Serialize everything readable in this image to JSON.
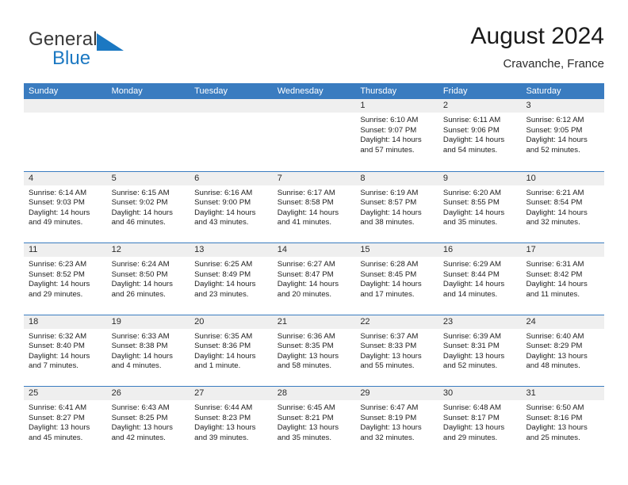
{
  "brand": {
    "line1": "General",
    "line2": "Blue",
    "mark": "triangle-logo",
    "colors": {
      "blue": "#1b78c2",
      "dark": "#3a3a3a"
    }
  },
  "header": {
    "title": "August 2024",
    "subtitle": "Cravanche, France"
  },
  "theme": {
    "header_blue": "#3a7cc0",
    "band_gray": "#efefef",
    "cell_white": "#ffffff"
  },
  "weekday_headers": [
    "Sunday",
    "Monday",
    "Tuesday",
    "Wednesday",
    "Thursday",
    "Friday",
    "Saturday"
  ],
  "weeks": [
    [
      {
        "day": "",
        "empty": true
      },
      {
        "day": "",
        "empty": true
      },
      {
        "day": "",
        "empty": true
      },
      {
        "day": "",
        "empty": true
      },
      {
        "day": "1",
        "sunrise": "Sunrise: 6:10 AM",
        "sunset": "Sunset: 9:07 PM",
        "daylight": "Daylight: 14 hours and 57 minutes."
      },
      {
        "day": "2",
        "sunrise": "Sunrise: 6:11 AM",
        "sunset": "Sunset: 9:06 PM",
        "daylight": "Daylight: 14 hours and 54 minutes."
      },
      {
        "day": "3",
        "sunrise": "Sunrise: 6:12 AM",
        "sunset": "Sunset: 9:05 PM",
        "daylight": "Daylight: 14 hours and 52 minutes."
      }
    ],
    [
      {
        "day": "4",
        "sunrise": "Sunrise: 6:14 AM",
        "sunset": "Sunset: 9:03 PM",
        "daylight": "Daylight: 14 hours and 49 minutes."
      },
      {
        "day": "5",
        "sunrise": "Sunrise: 6:15 AM",
        "sunset": "Sunset: 9:02 PM",
        "daylight": "Daylight: 14 hours and 46 minutes."
      },
      {
        "day": "6",
        "sunrise": "Sunrise: 6:16 AM",
        "sunset": "Sunset: 9:00 PM",
        "daylight": "Daylight: 14 hours and 43 minutes."
      },
      {
        "day": "7",
        "sunrise": "Sunrise: 6:17 AM",
        "sunset": "Sunset: 8:58 PM",
        "daylight": "Daylight: 14 hours and 41 minutes."
      },
      {
        "day": "8",
        "sunrise": "Sunrise: 6:19 AM",
        "sunset": "Sunset: 8:57 PM",
        "daylight": "Daylight: 14 hours and 38 minutes."
      },
      {
        "day": "9",
        "sunrise": "Sunrise: 6:20 AM",
        "sunset": "Sunset: 8:55 PM",
        "daylight": "Daylight: 14 hours and 35 minutes."
      },
      {
        "day": "10",
        "sunrise": "Sunrise: 6:21 AM",
        "sunset": "Sunset: 8:54 PM",
        "daylight": "Daylight: 14 hours and 32 minutes."
      }
    ],
    [
      {
        "day": "11",
        "sunrise": "Sunrise: 6:23 AM",
        "sunset": "Sunset: 8:52 PM",
        "daylight": "Daylight: 14 hours and 29 minutes."
      },
      {
        "day": "12",
        "sunrise": "Sunrise: 6:24 AM",
        "sunset": "Sunset: 8:50 PM",
        "daylight": "Daylight: 14 hours and 26 minutes."
      },
      {
        "day": "13",
        "sunrise": "Sunrise: 6:25 AM",
        "sunset": "Sunset: 8:49 PM",
        "daylight": "Daylight: 14 hours and 23 minutes."
      },
      {
        "day": "14",
        "sunrise": "Sunrise: 6:27 AM",
        "sunset": "Sunset: 8:47 PM",
        "daylight": "Daylight: 14 hours and 20 minutes."
      },
      {
        "day": "15",
        "sunrise": "Sunrise: 6:28 AM",
        "sunset": "Sunset: 8:45 PM",
        "daylight": "Daylight: 14 hours and 17 minutes."
      },
      {
        "day": "16",
        "sunrise": "Sunrise: 6:29 AM",
        "sunset": "Sunset: 8:44 PM",
        "daylight": "Daylight: 14 hours and 14 minutes."
      },
      {
        "day": "17",
        "sunrise": "Sunrise: 6:31 AM",
        "sunset": "Sunset: 8:42 PM",
        "daylight": "Daylight: 14 hours and 11 minutes."
      }
    ],
    [
      {
        "day": "18",
        "sunrise": "Sunrise: 6:32 AM",
        "sunset": "Sunset: 8:40 PM",
        "daylight": "Daylight: 14 hours and 7 minutes."
      },
      {
        "day": "19",
        "sunrise": "Sunrise: 6:33 AM",
        "sunset": "Sunset: 8:38 PM",
        "daylight": "Daylight: 14 hours and 4 minutes."
      },
      {
        "day": "20",
        "sunrise": "Sunrise: 6:35 AM",
        "sunset": "Sunset: 8:36 PM",
        "daylight": "Daylight: 14 hours and 1 minute."
      },
      {
        "day": "21",
        "sunrise": "Sunrise: 6:36 AM",
        "sunset": "Sunset: 8:35 PM",
        "daylight": "Daylight: 13 hours and 58 minutes."
      },
      {
        "day": "22",
        "sunrise": "Sunrise: 6:37 AM",
        "sunset": "Sunset: 8:33 PM",
        "daylight": "Daylight: 13 hours and 55 minutes."
      },
      {
        "day": "23",
        "sunrise": "Sunrise: 6:39 AM",
        "sunset": "Sunset: 8:31 PM",
        "daylight": "Daylight: 13 hours and 52 minutes."
      },
      {
        "day": "24",
        "sunrise": "Sunrise: 6:40 AM",
        "sunset": "Sunset: 8:29 PM",
        "daylight": "Daylight: 13 hours and 48 minutes."
      }
    ],
    [
      {
        "day": "25",
        "sunrise": "Sunrise: 6:41 AM",
        "sunset": "Sunset: 8:27 PM",
        "daylight": "Daylight: 13 hours and 45 minutes."
      },
      {
        "day": "26",
        "sunrise": "Sunrise: 6:43 AM",
        "sunset": "Sunset: 8:25 PM",
        "daylight": "Daylight: 13 hours and 42 minutes."
      },
      {
        "day": "27",
        "sunrise": "Sunrise: 6:44 AM",
        "sunset": "Sunset: 8:23 PM",
        "daylight": "Daylight: 13 hours and 39 minutes."
      },
      {
        "day": "28",
        "sunrise": "Sunrise: 6:45 AM",
        "sunset": "Sunset: 8:21 PM",
        "daylight": "Daylight: 13 hours and 35 minutes."
      },
      {
        "day": "29",
        "sunrise": "Sunrise: 6:47 AM",
        "sunset": "Sunset: 8:19 PM",
        "daylight": "Daylight: 13 hours and 32 minutes."
      },
      {
        "day": "30",
        "sunrise": "Sunrise: 6:48 AM",
        "sunset": "Sunset: 8:17 PM",
        "daylight": "Daylight: 13 hours and 29 minutes."
      },
      {
        "day": "31",
        "sunrise": "Sunrise: 6:50 AM",
        "sunset": "Sunset: 8:16 PM",
        "daylight": "Daylight: 13 hours and 25 minutes."
      }
    ]
  ]
}
